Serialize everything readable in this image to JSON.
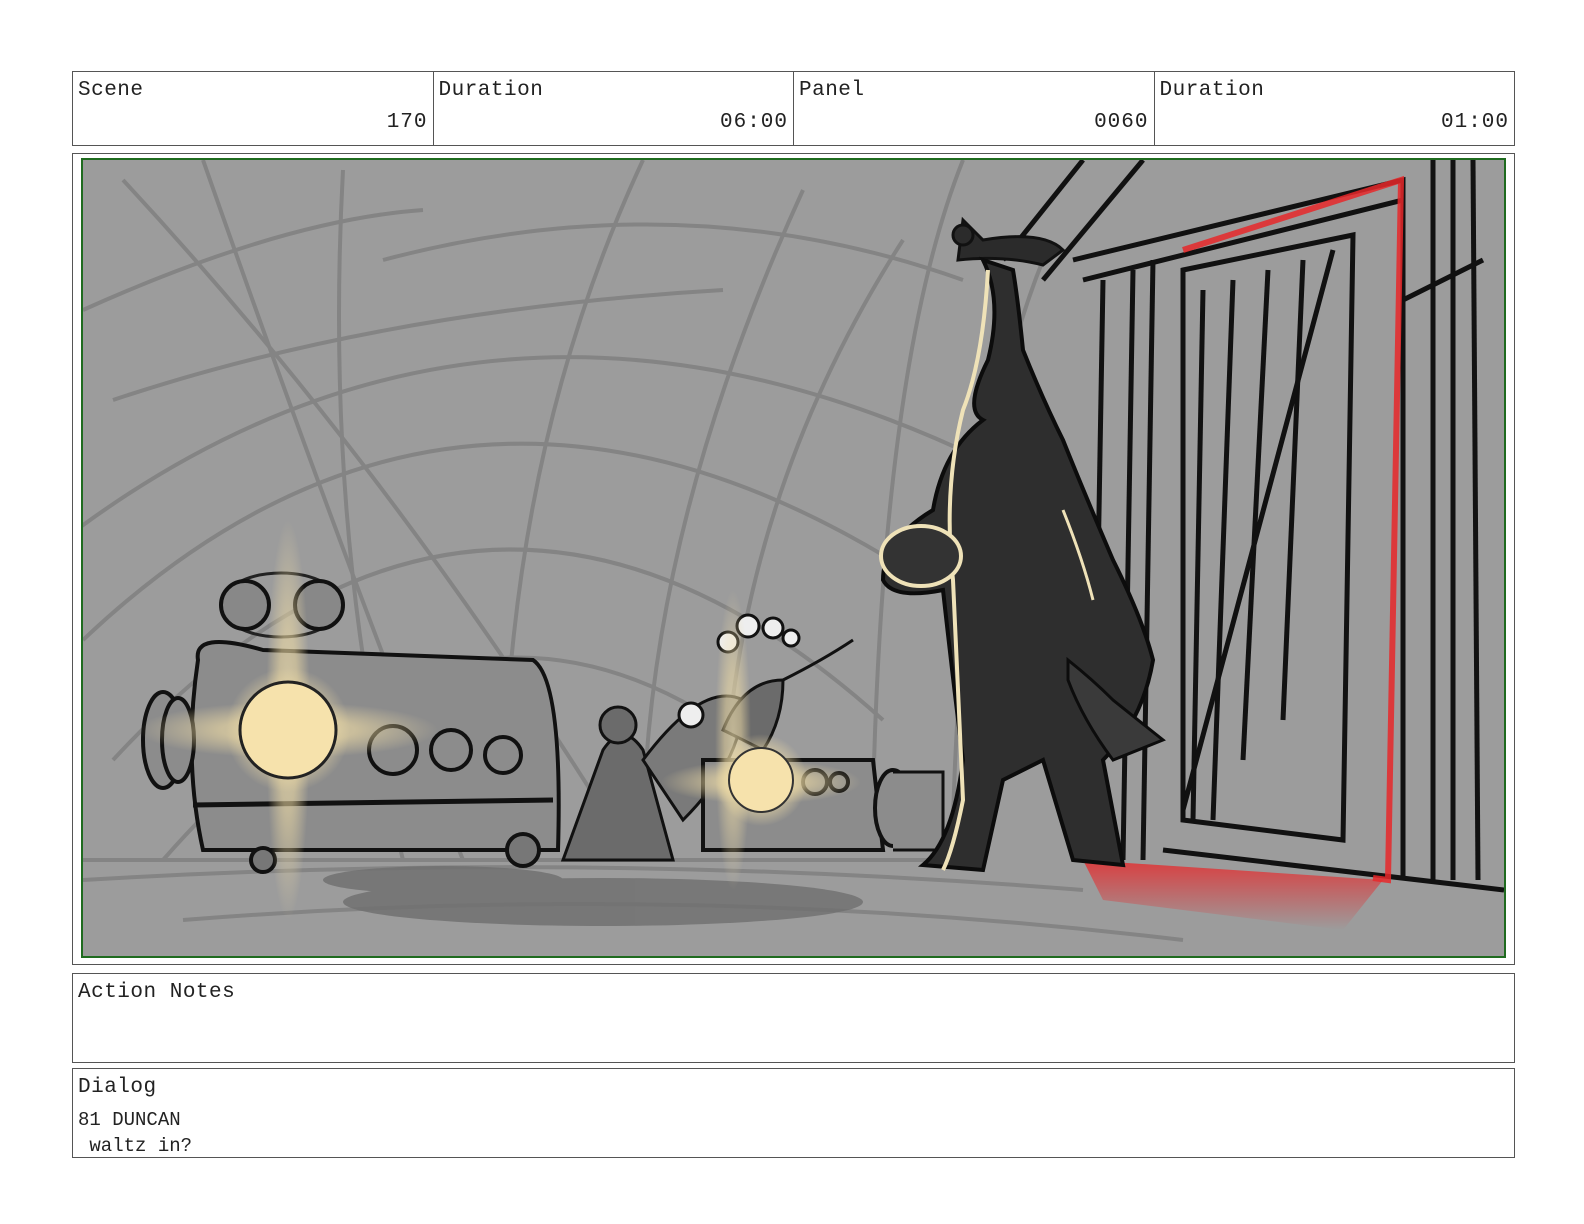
{
  "header": {
    "scene_label": "Scene",
    "scene_value": "170",
    "scene_duration_label": "Duration",
    "scene_duration_value": "06:00",
    "panel_label": "Panel",
    "panel_value": "0060",
    "panel_duration_label": "Duration",
    "panel_duration_value": "01:00"
  },
  "panel": {
    "frame_color": "#1f6b1f",
    "background_color": "#9c9c9c",
    "glow_color": "#f3dfa6",
    "door_accent_color": "#e8282a"
  },
  "action_notes": {
    "title": "Action Notes"
  },
  "dialog": {
    "title": "Dialog",
    "line_1": "81 DUNCAN",
    "line_2": " waltz in?"
  }
}
